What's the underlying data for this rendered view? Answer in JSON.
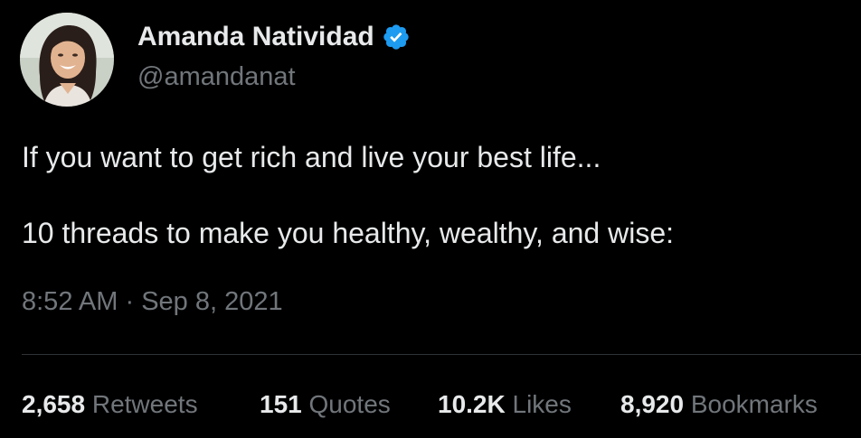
{
  "author": {
    "display_name": "Amanda Natividad",
    "handle": "@amandanat",
    "verified": true
  },
  "tweet": {
    "line1": "If you want to get rich and live your best life...",
    "line2": "10 threads to make you healthy, wealthy, and wise:",
    "time": "8:52 AM",
    "separator": "·",
    "date": "Sep 8, 2021"
  },
  "stats": {
    "retweets": {
      "count": "2,658",
      "label": "Retweets"
    },
    "quotes": {
      "count": "151",
      "label": "Quotes"
    },
    "likes": {
      "count": "10.2K",
      "label": "Likes"
    },
    "bookmarks": {
      "count": "8,920",
      "label": "Bookmarks"
    }
  },
  "colors": {
    "background": "#000000",
    "primary_text": "#e7e9ea",
    "secondary_text": "#71767b",
    "verified_badge": "#1d9bf0",
    "divider": "#2f3336"
  },
  "icons": {
    "verified": "verified-badge-icon",
    "avatar": "profile-photo"
  }
}
